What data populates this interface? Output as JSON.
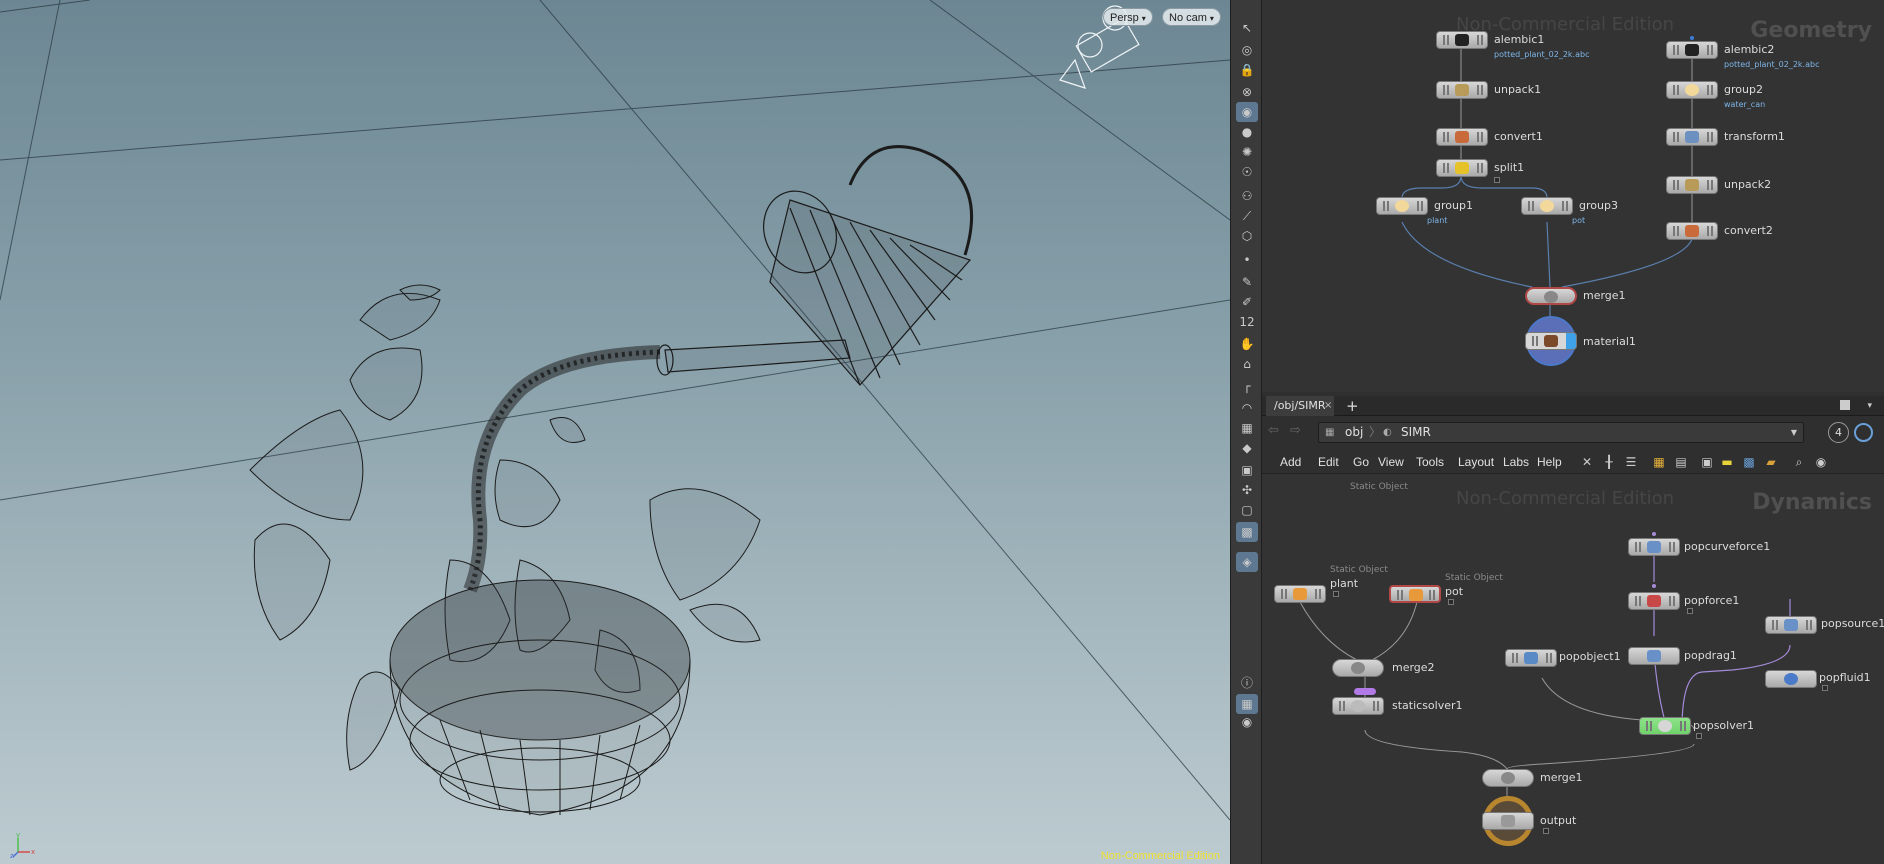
{
  "viewport": {
    "persp_label": "Persp",
    "cam_label": "No cam",
    "watermark": "Non-Commercial Edition",
    "axis_y": "y",
    "axis_x": "x",
    "axis_z": "z",
    "accent_color": "#f2e230"
  },
  "shelf": {
    "icons": [
      "select-icon",
      "view-icon",
      "lock-icon",
      "snap-icon",
      "camera-icon",
      "light-icon",
      "light2-icon",
      "pose-icon",
      "handle-icon",
      "brush-icon",
      "cube-icon",
      "dot-icon",
      "knife-icon",
      "pen-icon",
      "number-icon",
      "paint-icon",
      "stamp-icon",
      "ruler-icon",
      "angle-icon",
      "grid-icon",
      "lattice-icon",
      "image-icon",
      "pivot-icon",
      "box-icon",
      "render-icon",
      "pin-icon",
      "info-icon",
      "layout-icon",
      "eye-icon"
    ]
  },
  "geometry": {
    "context": "Geometry",
    "watermark": "Non-Commercial Edition",
    "nodes": {
      "alembic1": {
        "label": "alembic1",
        "sub": "potted_plant_02_2k.abc"
      },
      "alembic2": {
        "label": "alembic2",
        "sub": "potted_plant_02_2k.abc"
      },
      "unpack1": {
        "label": "unpack1"
      },
      "group2": {
        "label": "group2",
        "sub": "water_can"
      },
      "convert1": {
        "label": "convert1"
      },
      "transform1": {
        "label": "transform1"
      },
      "split1": {
        "label": "split1"
      },
      "unpack2": {
        "label": "unpack2"
      },
      "group1": {
        "label": "group1",
        "sub": "plant"
      },
      "group3": {
        "label": "group3",
        "sub": "pot"
      },
      "convert2": {
        "label": "convert2"
      },
      "merge1": {
        "label": "merge1"
      },
      "material1": {
        "label": "material1"
      }
    }
  },
  "tabs": {
    "path_tab": "/obj/SIMR",
    "close": "×",
    "add": "+"
  },
  "pathbar": {
    "back": "⇦",
    "forward": "⇨",
    "crumb_obj": "obj",
    "crumb_simr": "SIMR",
    "pin_number": "4"
  },
  "menu": {
    "items": [
      "Add",
      "Edit",
      "Go",
      "View",
      "Tools",
      "Layout",
      "Labs",
      "Help"
    ]
  },
  "dynamics": {
    "context": "Dynamics",
    "watermark": "Non-Commercial Edition",
    "nodes": {
      "plant": {
        "label": "plant",
        "note": "Static Object"
      },
      "pot": {
        "label": "pot",
        "note": "Static Object"
      },
      "merge2": {
        "label": "merge2"
      },
      "staticsolver1": {
        "label": "staticsolver1"
      },
      "popobject1": {
        "label": "popobject1"
      },
      "popcurveforce1": {
        "label": "popcurveforce1"
      },
      "popforce1": {
        "label": "popforce1"
      },
      "popdrag1": {
        "label": "popdrag1"
      },
      "popsource1": {
        "label": "popsource1"
      },
      "popfluid1": {
        "label": "popfluid1"
      },
      "popsolver1": {
        "label": "popsolver1"
      },
      "merge1": {
        "label": "merge1"
      },
      "output": {
        "label": "output"
      }
    }
  },
  "colors": {
    "wire_blue": "#5a7fae",
    "wire_grey": "#9a9a9a",
    "wire_purple": "#a58ad8",
    "solver_green": "#6fd36a",
    "selected_red": "#b04848",
    "output_ring": "#b8862e",
    "display_ring": "#4b78c8"
  }
}
